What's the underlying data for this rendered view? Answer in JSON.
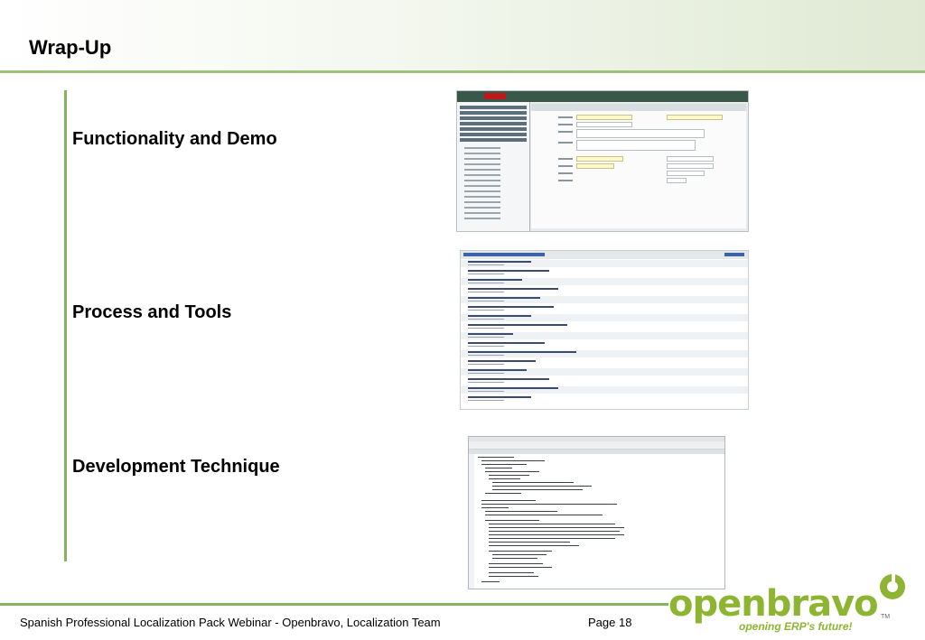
{
  "slide": {
    "title": "Wrap-Up",
    "sections": [
      "Functionality and Demo",
      "Process and Tools",
      "Development Technique"
    ],
    "footer": "Spanish Professional Localization Pack Webinar - Openbravo, Localization Team",
    "page": "Page 18"
  },
  "logo": {
    "wordmark": "openbravo",
    "slogan": "opening ERP's future!",
    "tm": "TM",
    "icon": "openbravo-swirl-icon"
  },
  "colors": {
    "accent": "#86b35f",
    "brand": "#8db532"
  }
}
